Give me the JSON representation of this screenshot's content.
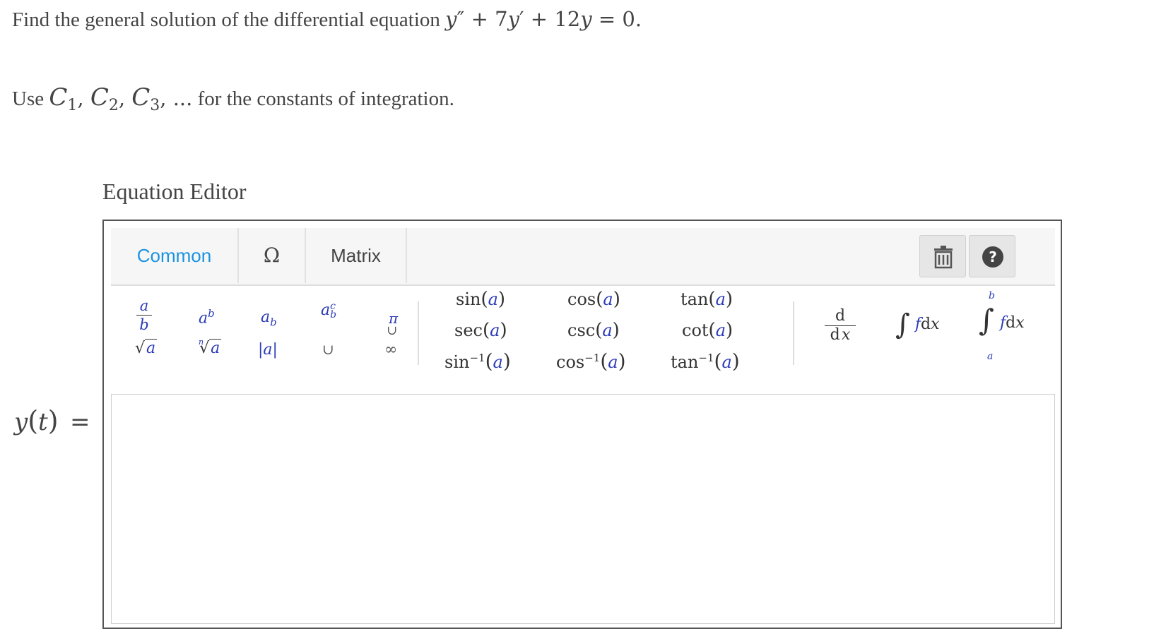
{
  "question": {
    "line1_prefix": "Find the general solution of the differential equation ",
    "eq_y": "y",
    "eq_pp": "″",
    "eq_plus1": " + ",
    "eq_coef1": "7",
    "eq_y2": "y",
    "eq_p": "′",
    "eq_plus2": " + ",
    "eq_coef2": "12",
    "eq_y3": "y",
    "eq_eq": " = ",
    "eq_zero": "0",
    "eq_period": ".",
    "line2_prefix": "Use ",
    "c": "C",
    "sub1": "1",
    "sub2": "2",
    "sub3": "3",
    "comma": ", ",
    "ellipsis": "...",
    "line2_suffix": " for the constants of integration."
  },
  "editor": {
    "title": "Equation Editor",
    "tabs": [
      "Common",
      "Ω",
      "Matrix"
    ],
    "buttons": {
      "trash": "trash-icon",
      "help": "?"
    },
    "palette": {
      "a": "a",
      "b": "b",
      "c": "c",
      "n": "n",
      "pi": "π",
      "infinity": "∞",
      "union": "∪",
      "superset": "⊃",
      "abs": "|a|",
      "sin": "sin",
      "cos": "cos",
      "tan": "tan",
      "sec": "sec",
      "csc": "csc",
      "cot": "cot",
      "inv": "−1",
      "lp": "(",
      "rp": ")",
      "d": "d",
      "x": "x",
      "f": "f",
      "int": "∫"
    }
  },
  "answer": {
    "label_y": "y",
    "label_t": "t",
    "lp": "(",
    "rp": ")",
    "eq": "=",
    "value": ""
  },
  "colors": {
    "accent": "#1a93e0",
    "variable": "#2b3bb8",
    "border": "#555555"
  }
}
